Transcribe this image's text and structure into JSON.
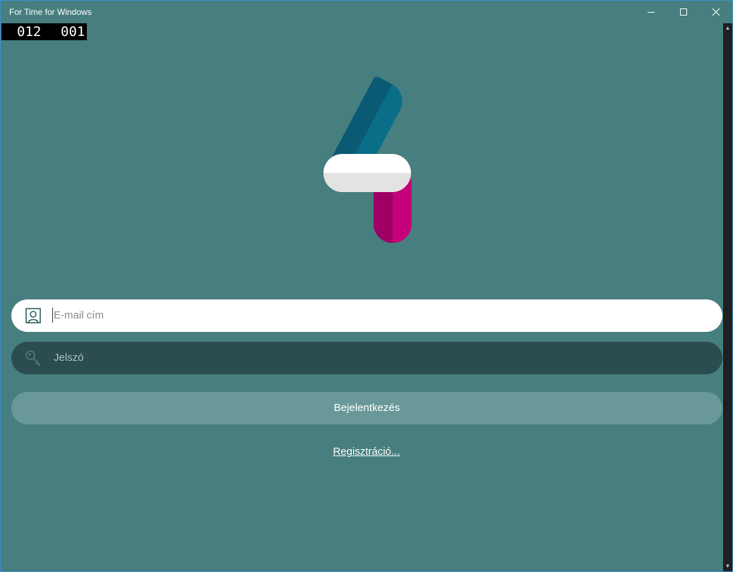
{
  "window": {
    "title": "For Time for Windows",
    "minimize_icon": "minimize-icon",
    "maximize_icon": "maximize-icon",
    "close_icon": "close-icon"
  },
  "counter": {
    "left": "012",
    "right": "001"
  },
  "logo": {
    "icon": "app-logo-4",
    "colors": {
      "blue": "#0b6e88",
      "blue_dark": "#0a5a73",
      "pink": "#c4007a",
      "pink_dark": "#9e0066",
      "pill": "#ececec"
    }
  },
  "form": {
    "email": {
      "placeholder": "E-mail cím",
      "value": "",
      "icon": "user-icon"
    },
    "password": {
      "placeholder": "Jelszó",
      "value": "",
      "icon": "key-icon"
    },
    "login_label": "Bejelentkezés",
    "register_label": "Regisztráció..."
  },
  "colors": {
    "background": "#477e7f",
    "password_field_bg": "#2b4d4f",
    "button_bg": "#6a9899",
    "text": "#ffffff"
  }
}
